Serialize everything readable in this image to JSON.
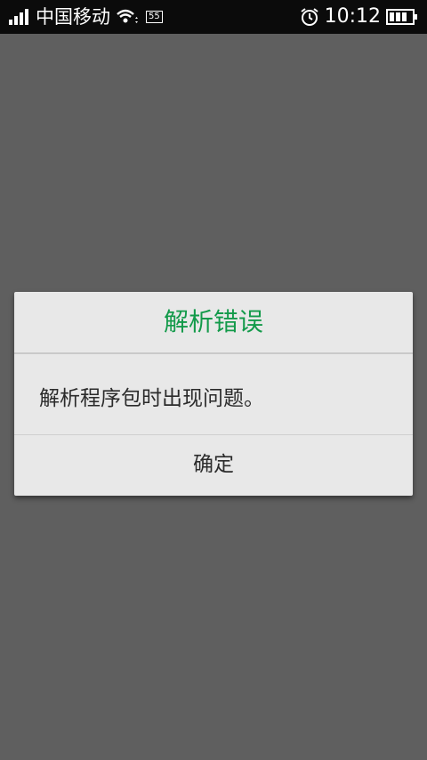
{
  "status_bar": {
    "carrier": "中国移动",
    "network_badge": "55",
    "time": "10:12",
    "icons": [
      "signal-icon",
      "wifi-icon",
      "alarm-icon",
      "battery-icon"
    ]
  },
  "dialog": {
    "title": "解析错误",
    "message": "解析程序包时出现问题。",
    "ok_button": "确定"
  },
  "colors": {
    "title": "#139a4a",
    "overlay": "#5f5f5f",
    "dialog_bg": "#e8e8e8",
    "status_bar_bg": "#0b0b0b"
  }
}
